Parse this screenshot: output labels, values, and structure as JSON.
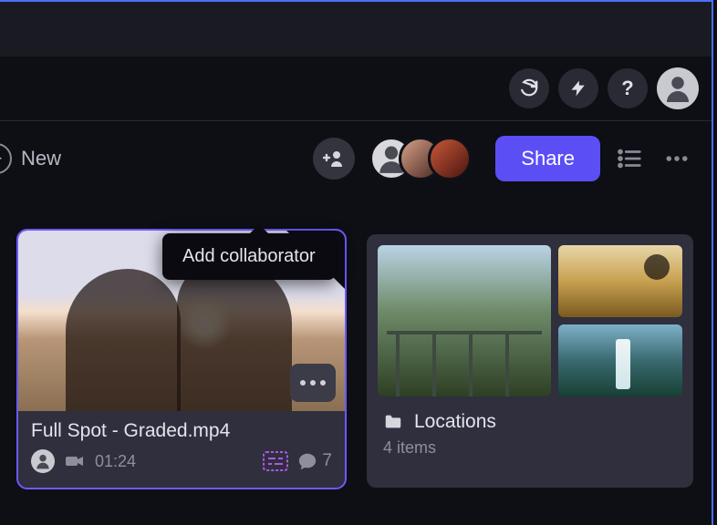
{
  "toolbar": {
    "new_label": "New",
    "share_label": "Share"
  },
  "tooltip": {
    "add_collaborator": "Add collaborator"
  },
  "video_card": {
    "title": "Full Spot - Graded.mp4",
    "duration": "01:24",
    "comment_count": "7"
  },
  "folder_card": {
    "title": "Locations",
    "item_count": "4 items"
  }
}
